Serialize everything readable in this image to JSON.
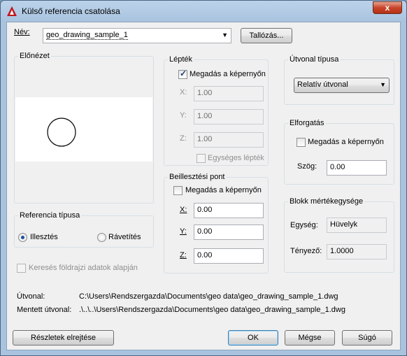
{
  "window": {
    "title": "Külső referencia csatolása",
    "close_glyph": "x"
  },
  "name": {
    "label": "Név:",
    "value": "geo_drawing_sample_1",
    "browse_label": "Tallózás..."
  },
  "preview": {
    "label": "Előnézet"
  },
  "scale": {
    "label": "Lépték",
    "specify_onscreen": "Megadás a képernyőn",
    "x_label": "X:",
    "x_value": "1.00",
    "y_label": "Y:",
    "y_value": "1.00",
    "z_label": "Z:",
    "z_value": "1.00",
    "uniform_label": "Egységes lépték"
  },
  "insertion": {
    "label": "Beillesztési pont",
    "specify_onscreen": "Megadás a képernyőn",
    "x_label": "X:",
    "x_value": "0.00",
    "y_label": "Y:",
    "y_value": "0.00",
    "z_label": "Z:",
    "z_value": "0.00"
  },
  "path_type": {
    "label": "Útvonal típusa",
    "value": "Relatív útvonal"
  },
  "rotation": {
    "label": "Elforgatás",
    "specify_onscreen": "Megadás a képernyőn",
    "angle_label": "Szög:",
    "angle_value": "0.00"
  },
  "block_unit": {
    "label": "Blokk mértékegysége",
    "unit_label": "Egység:",
    "unit_value": "Hüvelyk",
    "factor_label": "Tényező:",
    "factor_value": "1.0000"
  },
  "ref_type": {
    "label": "Referencia típusa",
    "attach": "Illesztés",
    "overlay": "Rávetítés"
  },
  "geo_search": "Keresés földrajzi adatok alapján",
  "paths": {
    "path_label": "Útvonal:",
    "path_value": "C:\\Users\\Rendszergazda\\Documents\\geo data\\geo_drawing_sample_1.dwg",
    "saved_label": "Mentett útvonal:",
    "saved_value": ".\\..\\..\\Users\\Rendszergazda\\Documents\\geo data\\geo_drawing_sample_1.dwg"
  },
  "buttons": {
    "hide_details": "Részletek elrejtése",
    "ok": "OK",
    "cancel": "Mégse",
    "help": "Súgó"
  },
  "colors": {
    "accent_icon": "#c0141c",
    "close_button": "#c8452a"
  }
}
